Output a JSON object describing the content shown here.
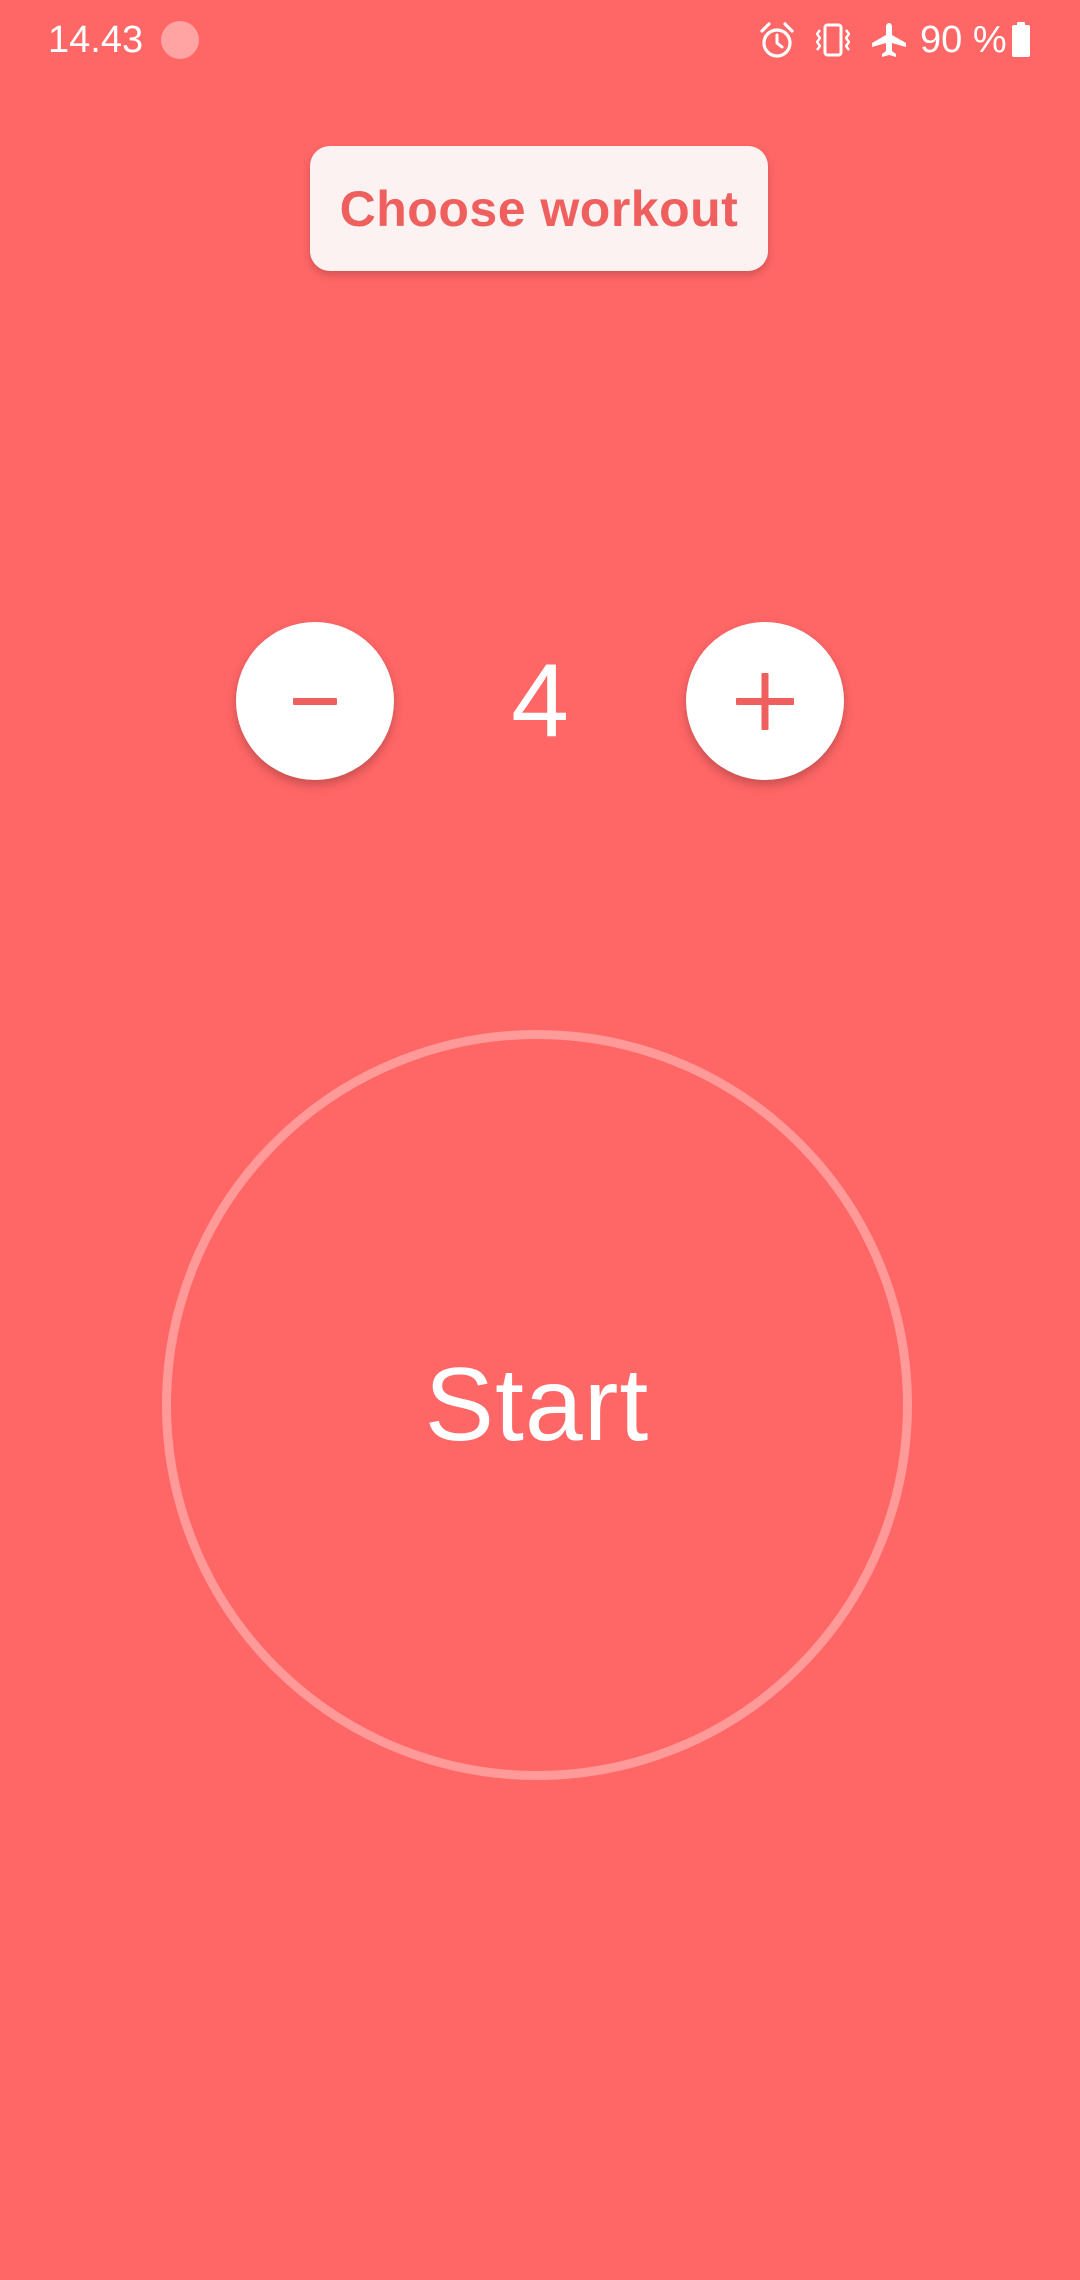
{
  "status_bar": {
    "time": "14.43",
    "battery_percent": "90 %",
    "icons": [
      "notification-dot-icon",
      "alarm-icon",
      "vibrate-icon",
      "airplane-mode-icon",
      "battery-icon"
    ]
  },
  "workout_selector": {
    "label": "Choose workout"
  },
  "stepper": {
    "value": "4",
    "decrement_icon": "minus-icon",
    "increment_icon": "plus-icon"
  },
  "start": {
    "label": "Start"
  },
  "colors": {
    "background": "#FF6666",
    "button_surface": "#FCF2F1",
    "accent_text": "#EE5F5E",
    "ring": "#FF9A99",
    "white": "#FFFFFF"
  }
}
